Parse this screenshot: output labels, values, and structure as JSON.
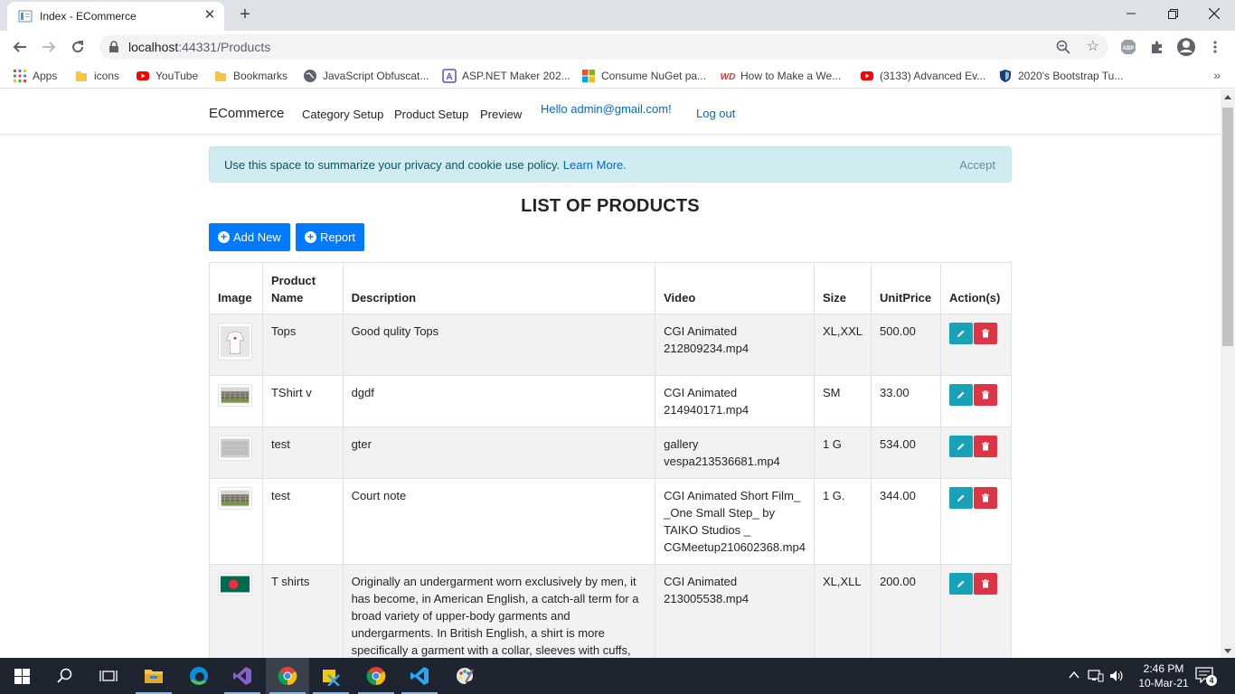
{
  "browser": {
    "tab_title": "Index - ECommerce",
    "url_host": "localhost",
    "url_port": ":44331",
    "url_path": "/Products",
    "bookmarks": [
      {
        "label": "Apps",
        "icon": "apps-grid-icon"
      },
      {
        "label": "icons",
        "icon": "folder-icon"
      },
      {
        "label": "YouTube",
        "icon": "youtube-icon"
      },
      {
        "label": "Bookmarks",
        "icon": "folder-icon"
      },
      {
        "label": "JavaScript Obfuscat...",
        "icon": "globe-icon"
      },
      {
        "label": "ASP.NET Maker 202...",
        "icon": "aspnet-maker-icon"
      },
      {
        "label": "Consume NuGet pa...",
        "icon": "microsoft-icon"
      },
      {
        "label": "How to Make a We...",
        "icon": "wd-icon"
      },
      {
        "label": "(3133) Advanced Ev...",
        "icon": "youtube-icon"
      },
      {
        "label": "2020's Bootstrap Tu...",
        "icon": "shield-icon"
      }
    ]
  },
  "site": {
    "brand": "ECommerce",
    "nav": [
      "Category Setup",
      "Product Setup",
      "Preview"
    ],
    "hello": "Hello admin@gmail.com!",
    "logout": "Log out"
  },
  "cookie": {
    "message": "Use this space to summarize your privacy and cookie use policy.",
    "learn_more": "Learn More.",
    "accept": "Accept"
  },
  "page": {
    "heading": "LIST OF PRODUCTS",
    "add_new": "Add New",
    "report": "Report"
  },
  "table": {
    "headers": {
      "image": "Image",
      "product_name": "Product Name",
      "description": "Description",
      "video": "Video",
      "size": "Size",
      "unit_price": "UnitPrice",
      "actions": "Action(s)"
    },
    "rows": [
      {
        "thumb": "tops-photo",
        "name": "Tops",
        "description": "Good qulity Tops",
        "video": "CGI Animated 212809234.mp4",
        "size": "XL,XXL",
        "price": "500.00"
      },
      {
        "thumb": "fence-photo",
        "name": "TShirt v",
        "description": "dgdf",
        "video": "CGI Animated 214940171.mp4",
        "size": "SM",
        "price": "33.00"
      },
      {
        "thumb": "grey-photo",
        "name": "test",
        "description": "gter",
        "video": "gallery vespa213536681.mp4",
        "size": "1 G",
        "price": "534.00"
      },
      {
        "thumb": "fence-photo",
        "name": "test",
        "description": "Court note",
        "video": "CGI Animated Short Film_ _One Small Step_ by TAIKO Studios _ CGMeetup210602368.mp4",
        "size": "1 G.",
        "price": "344.00"
      },
      {
        "thumb": "bangladesh-flag",
        "name": "T shirts",
        "description": "Originally an undergarment worn exclusively by men, it has become, in American English, a catch-all term for a broad variety of upper-body garments and undergarments. In British English, a shirt is more specifically a garment with a collar, sleeves with cuffs,",
        "video": "CGI Animated 213005538.mp4",
        "size": "XL,XLL",
        "price": "200.00"
      }
    ]
  },
  "taskbar": {
    "time": "2:46 PM",
    "date": "10-Mar-21",
    "notifications": "4"
  },
  "colors": {
    "primary": "#007bff",
    "info": "#17a2b8",
    "danger": "#dc3545",
    "alert_bg": "#d1ecf1"
  }
}
